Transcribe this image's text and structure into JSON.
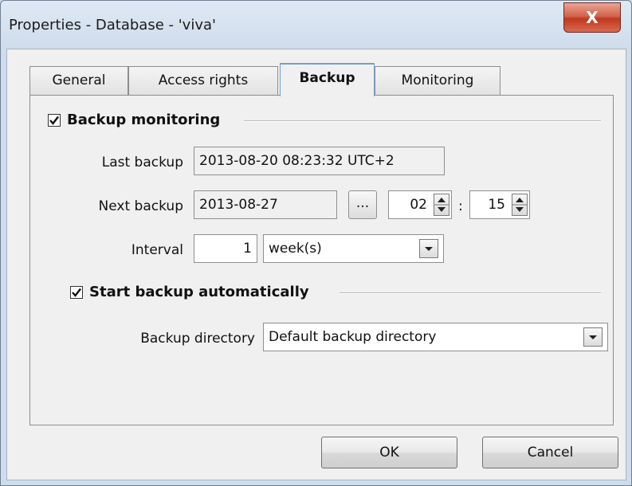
{
  "window": {
    "title": "Properties - Database - 'viva'",
    "close_glyph": "X"
  },
  "tabs": [
    {
      "label": "General",
      "active": false
    },
    {
      "label": "Access rights",
      "active": false
    },
    {
      "label": "Backup",
      "active": true
    },
    {
      "label": "Monitoring",
      "active": false
    }
  ],
  "backup_monitoring": {
    "label": "Backup monitoring",
    "checked": true,
    "last_backup_label": "Last backup",
    "last_backup_value": "2013-08-20 08:23:32 UTC+2",
    "next_backup_label": "Next backup",
    "next_backup_date": "2013-08-27",
    "browse_label": "...",
    "hour": "02",
    "time_separator": ":",
    "minute": "15",
    "interval_label": "Interval",
    "interval_value": "1",
    "interval_unit": "week(s)"
  },
  "start_backup": {
    "label": "Start backup automatically",
    "checked": true,
    "directory_label": "Backup directory",
    "directory_value": "Default backup directory"
  },
  "footer": {
    "ok_label": "OK",
    "cancel_label": "Cancel"
  }
}
